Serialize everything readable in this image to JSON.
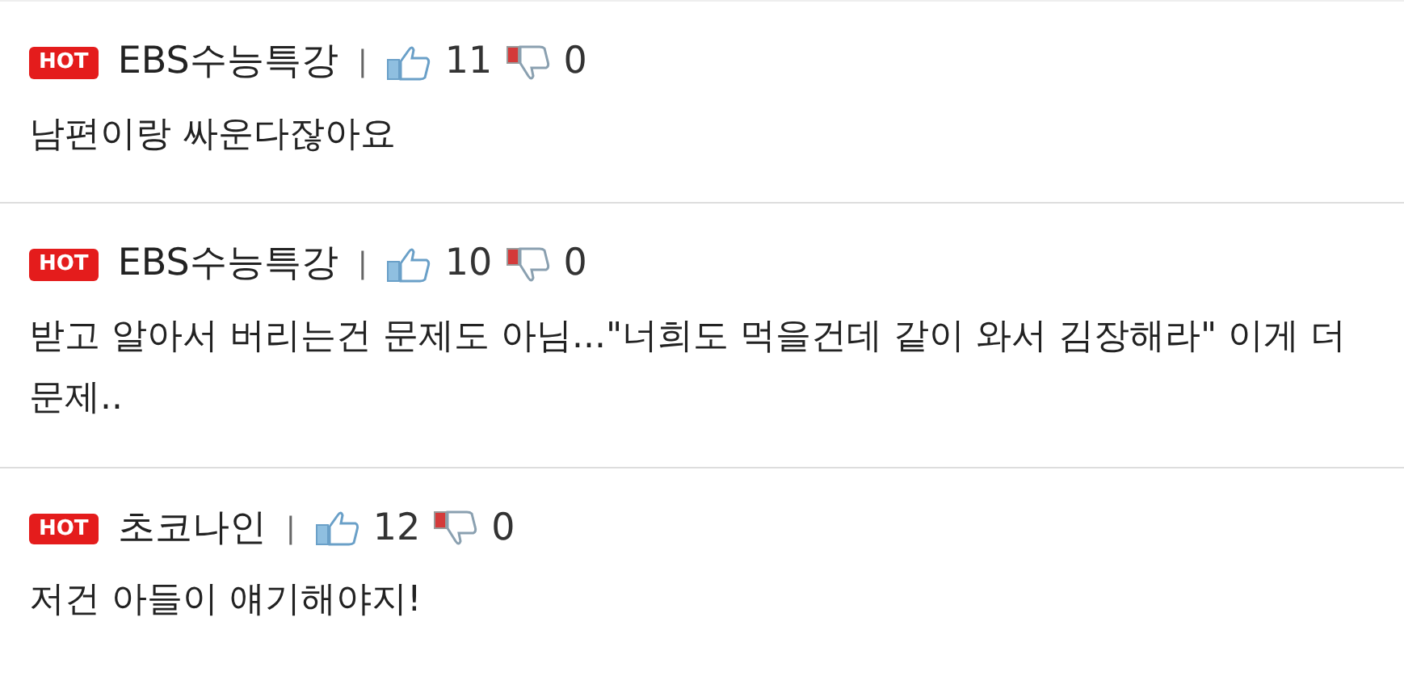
{
  "comments": [
    {
      "badge": "HOT",
      "author": "EBS수능특강",
      "separator": "|",
      "likes": "11",
      "dislikes": "0",
      "text": "남편이랑 싸운다잖아요"
    },
    {
      "badge": "HOT",
      "author": "EBS수능특강",
      "separator": "|",
      "likes": "10",
      "dislikes": "0",
      "text": "받고 알아서 버리는건 문제도 아님...\"너희도 먹을건데 같이 와서 김장해라\" 이게 더 문제.."
    },
    {
      "badge": "HOT",
      "author": "초코나인",
      "separator": "|",
      "likes": "12",
      "dislikes": "0",
      "text": "저건 아들이 얘기해야지!"
    }
  ]
}
